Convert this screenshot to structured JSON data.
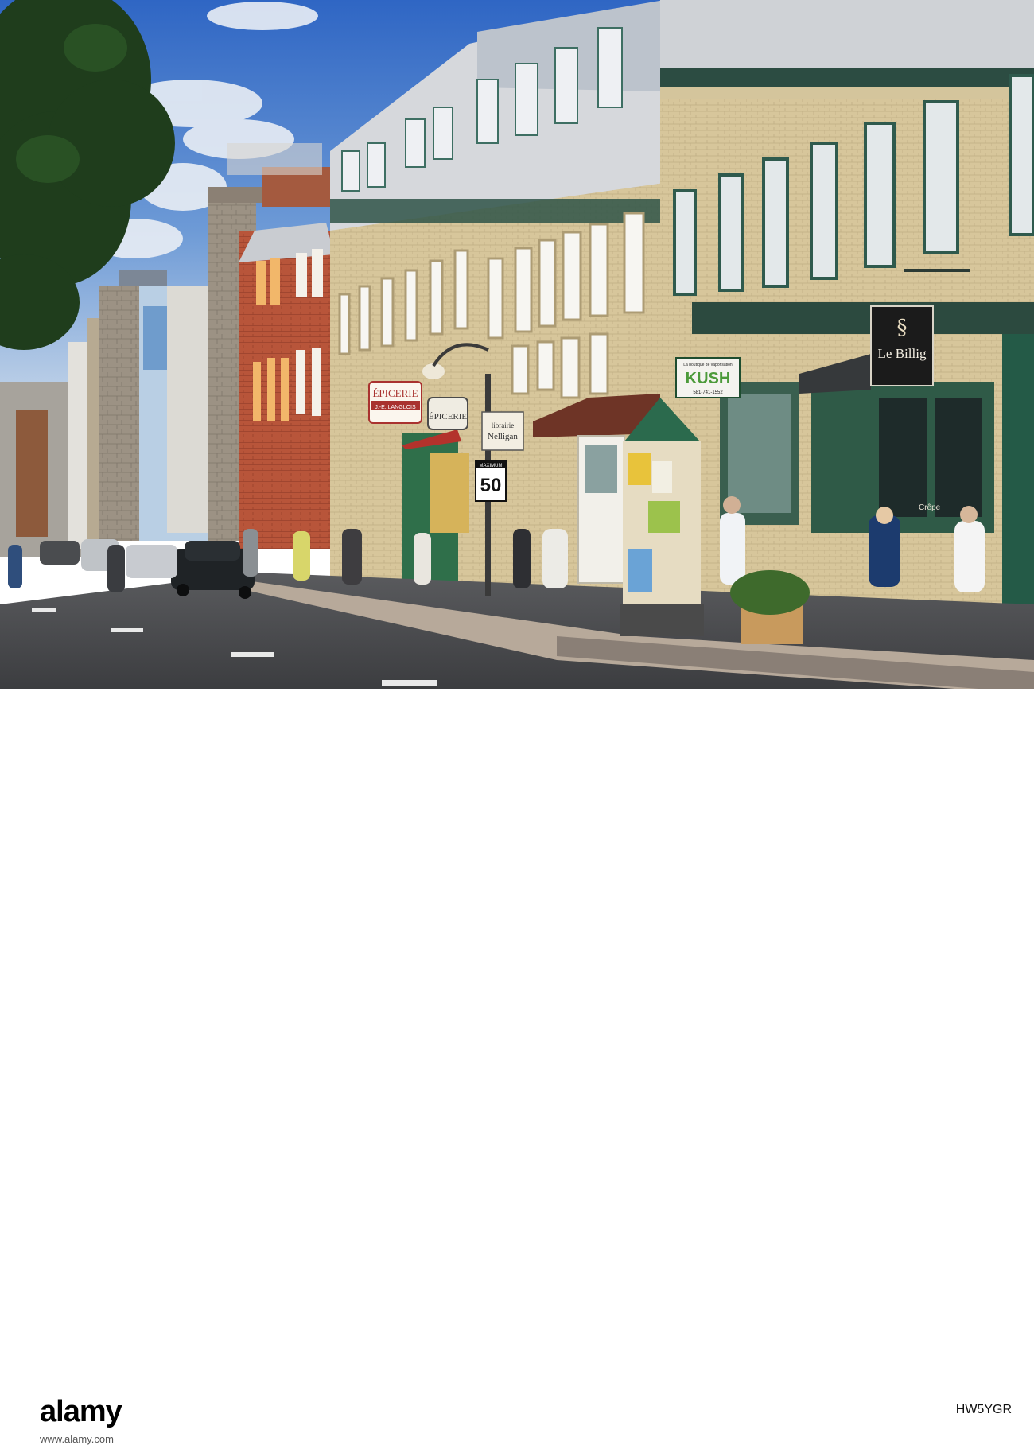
{
  "signs": {
    "epicerie_top": "ÉPICERIE",
    "epicerie_sub": "J.-E. LANGLOIS",
    "epicerie_hanging": "ÉPICERIE",
    "librairie_line1": "librairie",
    "librairie_line2": "Nelligan",
    "speed_max": "MAXIMUM",
    "speed_value": "50",
    "kush_top": "La boutique de vaporisation",
    "kush_name": "KUSH",
    "kush_phone": "581-741-1552",
    "le_billig": "Le Billig",
    "crepe_window": "Crêpe"
  },
  "watermark": {
    "brand": "alamy",
    "image_id": "HW5YGR",
    "url": "www.alamy.com"
  }
}
